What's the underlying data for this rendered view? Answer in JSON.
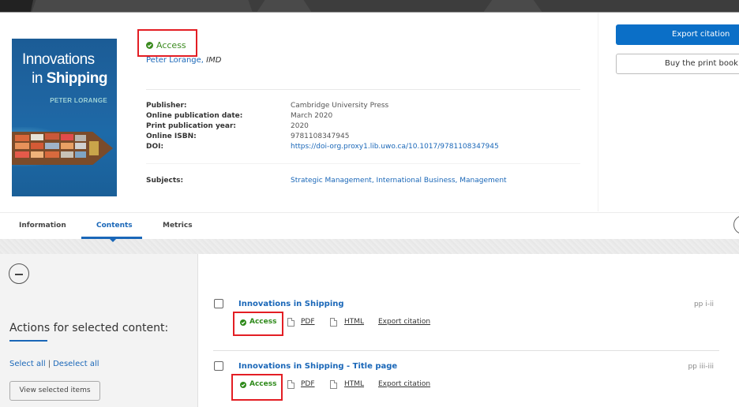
{
  "book": {
    "cover": {
      "title_line1": "Innovations",
      "title_line2_prefix": "in ",
      "title_line2_bold": "Shipping",
      "author": "PETER LORANGE"
    },
    "access_label": "Access",
    "author_name": "Peter Lorange",
    "author_affiliation": "IMD",
    "meta": [
      {
        "label": "Publisher:",
        "value": "Cambridge University Press",
        "link": false
      },
      {
        "label": "Online publication date:",
        "value": "March 2020",
        "link": false
      },
      {
        "label": "Print publication year:",
        "value": "2020",
        "link": false
      },
      {
        "label": "Online ISBN:",
        "value": "9781108347945",
        "link": false
      },
      {
        "label": "DOI:",
        "value": "https://doi-org.proxy1.lib.uwo.ca/10.1017/9781108347945",
        "link": true
      }
    ],
    "subjects_label": "Subjects:",
    "subjects_value": "Strategic Management, International Business, Management"
  },
  "sidebar_actions": {
    "export_citation": "Export citation",
    "buy_print": "Buy the print book"
  },
  "tabs": [
    {
      "label": "Information",
      "active": false
    },
    {
      "label": "Contents",
      "active": true
    },
    {
      "label": "Metrics",
      "active": false
    }
  ],
  "left_panel": {
    "title": "Actions for selected content:",
    "select_all": "Select all",
    "separator": "|",
    "deselect_all": "Deselect all",
    "view_selected": "View selected items"
  },
  "contents": [
    {
      "title": "Innovations in Shipping",
      "access": "Access",
      "pdf": "PDF",
      "html": "HTML",
      "export": "Export citation",
      "pages": "pp i-ii"
    },
    {
      "title": "Innovations in Shipping - Title page",
      "access": "Access",
      "pdf": "PDF",
      "html": "HTML",
      "export": "Export citation",
      "pages": "pp iii-iii"
    }
  ],
  "colors": {
    "accent_blue": "#1a67b8",
    "button_blue": "#0b6fc7",
    "access_green": "#2e8a1a",
    "highlight_red": "#e31e24"
  }
}
